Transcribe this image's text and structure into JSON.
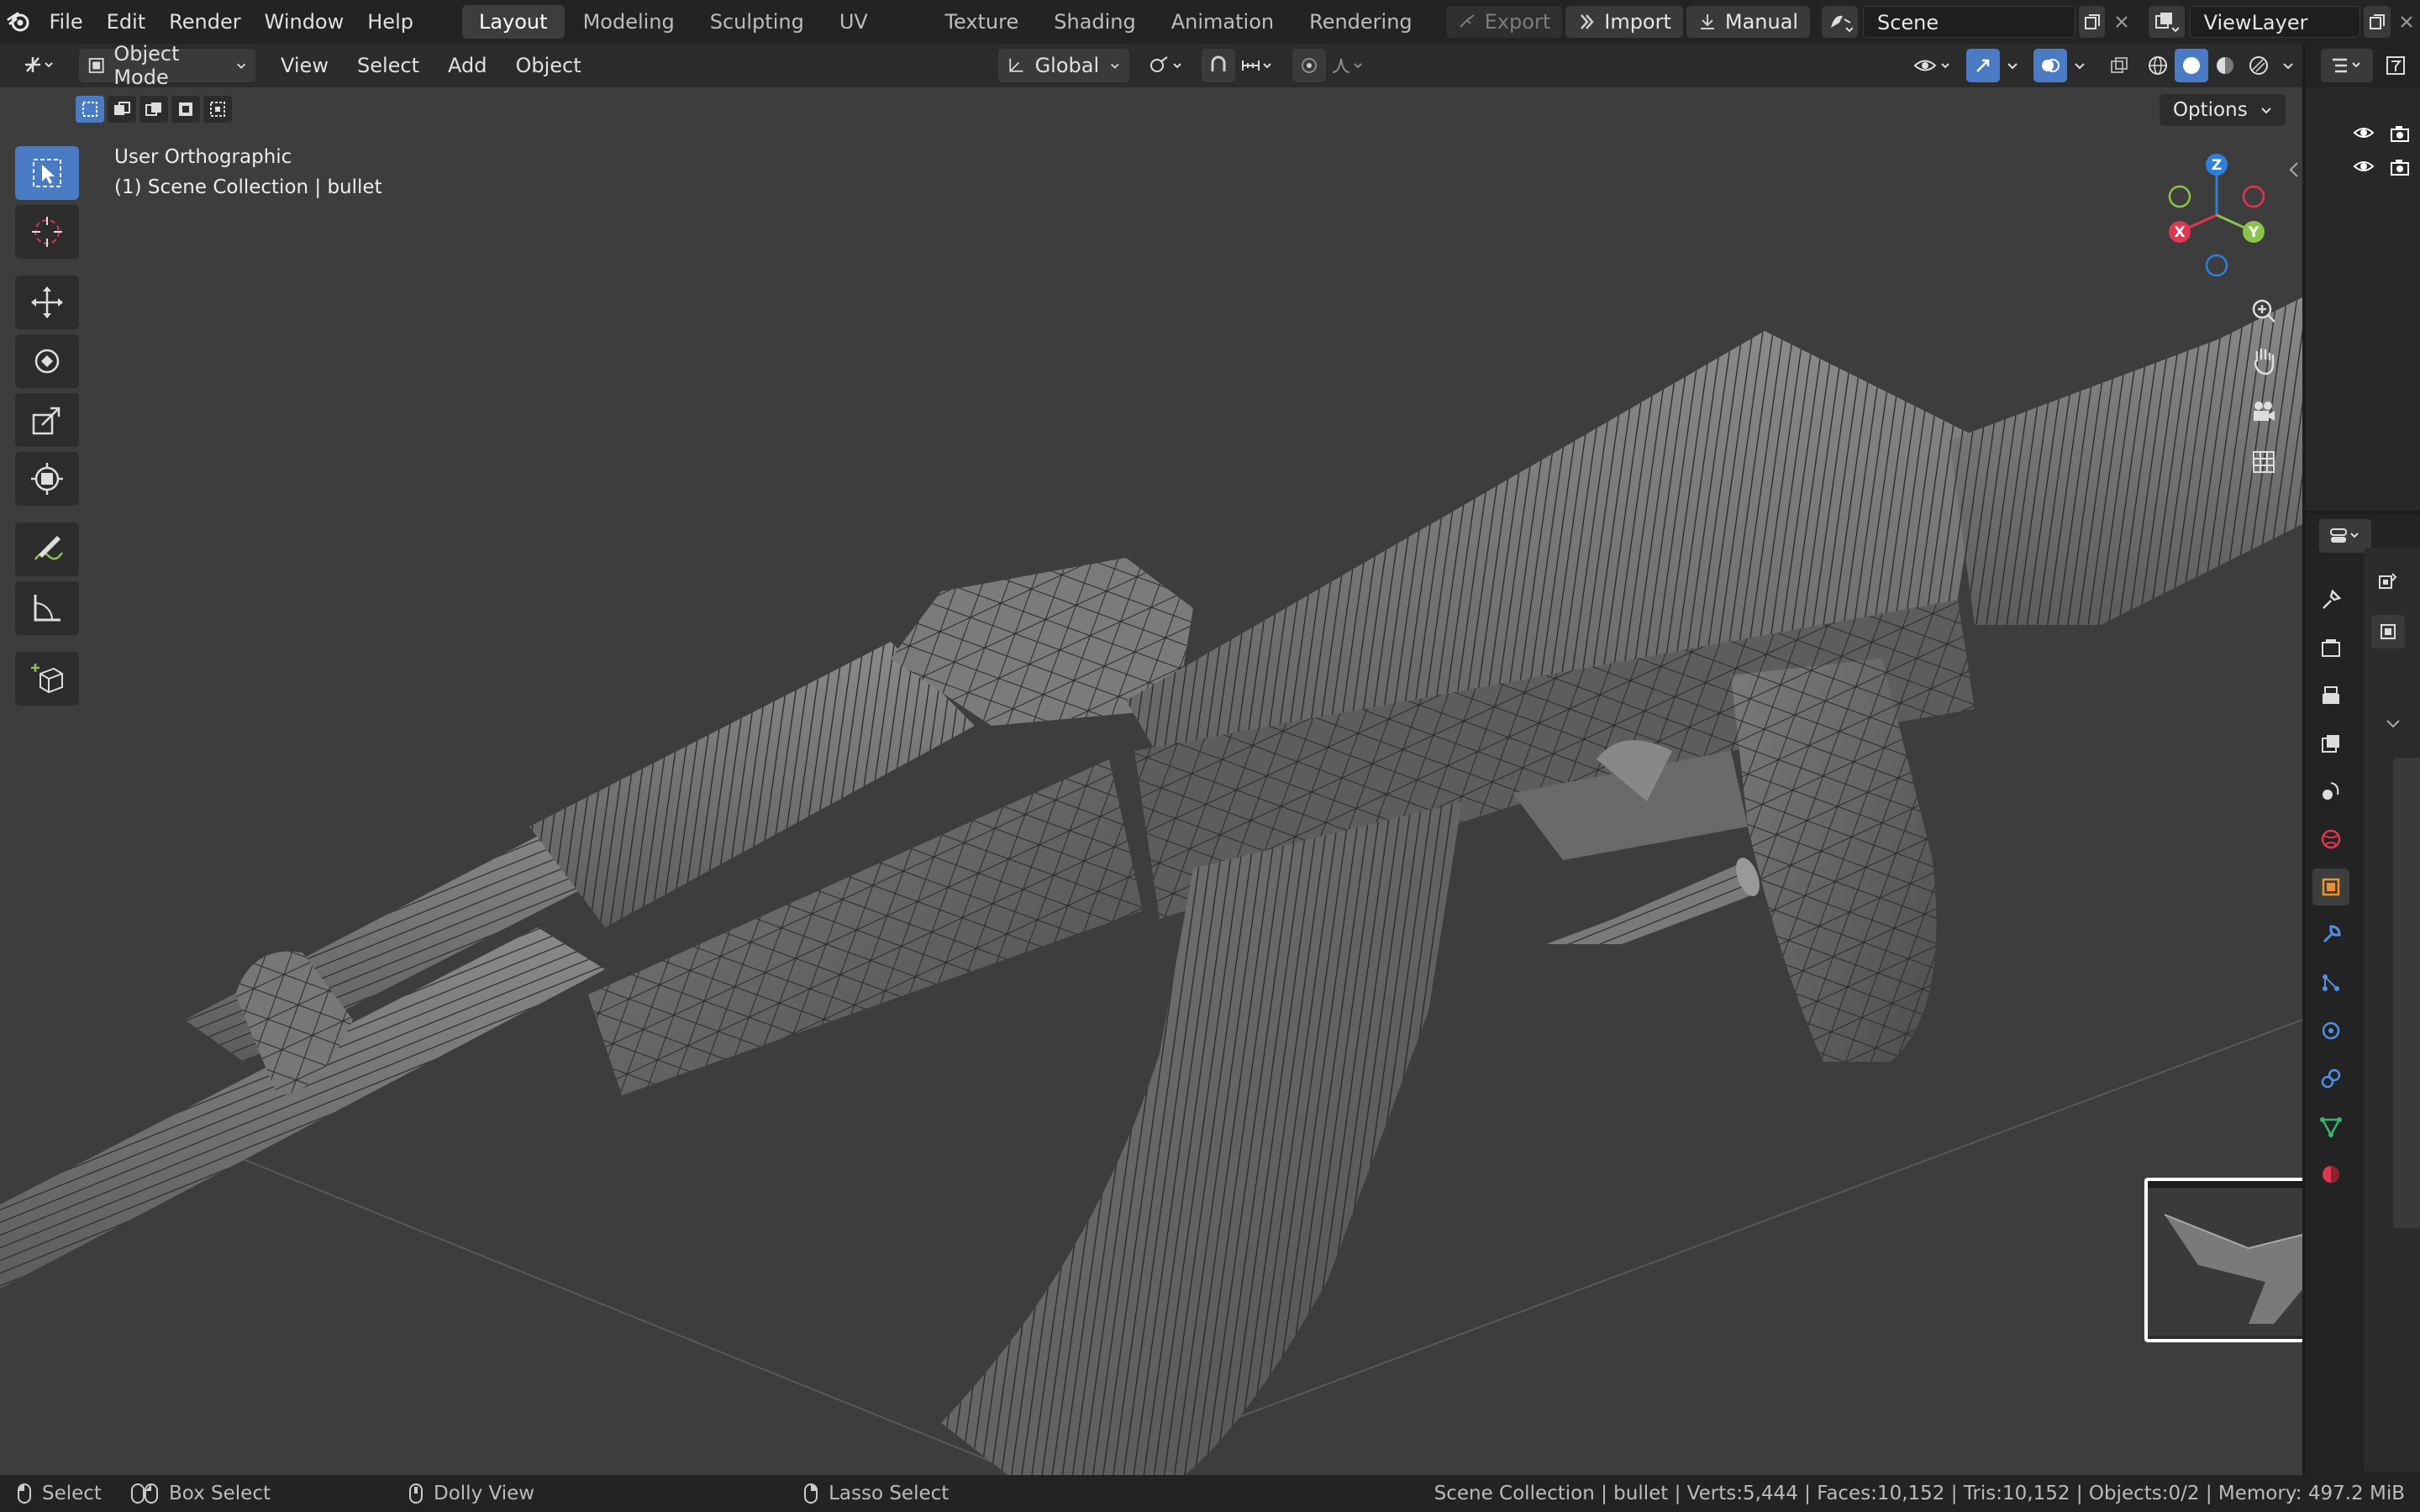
{
  "topbar": {
    "menus": [
      "File",
      "Edit",
      "Render",
      "Window",
      "Help"
    ],
    "workspaces": [
      "Layout",
      "Modeling",
      "Sculpting",
      "UV Editing",
      "Texture Paint",
      "Shading",
      "Animation",
      "Rendering"
    ],
    "active_workspace": "Layout",
    "export_label": "Export",
    "import_label": "Import",
    "manual_label": "Manual",
    "scene_name": "Scene",
    "view_layer_name": "ViewLayer"
  },
  "header": {
    "mode": "Object Mode",
    "menus": [
      "View",
      "Select",
      "Add",
      "Object"
    ],
    "transform_orientation": "Global"
  },
  "viewport": {
    "view_name": "User Orthographic",
    "collection_info": "(1) Scene Collection | bullet",
    "options_label": "Options",
    "gizmo": {
      "x": "X",
      "y": "Y",
      "z": "Z"
    }
  },
  "toolbar": {
    "tools": [
      "select-box",
      "cursor",
      "move",
      "rotate",
      "scale",
      "transform",
      "annotate",
      "measure",
      "add-cube"
    ],
    "active_tool": "select-box"
  },
  "properties": {
    "tabs": [
      "tool",
      "render",
      "output",
      "view-layer",
      "scene",
      "world",
      "object",
      "modifiers",
      "particles",
      "physics",
      "constraints",
      "data",
      "material"
    ],
    "active_tab": "object"
  },
  "statusbar": {
    "left_items": [
      {
        "label": "Select"
      },
      {
        "label": "Box Select"
      },
      {
        "label": "Dolly View"
      },
      {
        "label": "Lasso Select"
      }
    ],
    "stats": "Scene Collection | bullet | Verts:5,444 | Faces:10,152 | Tris:10,152 | Objects:0/2 | Memory: 497.2 MiB"
  },
  "colors": {
    "accent": "#4a7bc4",
    "axis_x": "#e0364f",
    "axis_y": "#8bc34a",
    "axis_z": "#2f7fdc",
    "object_orange": "#f0912f"
  }
}
